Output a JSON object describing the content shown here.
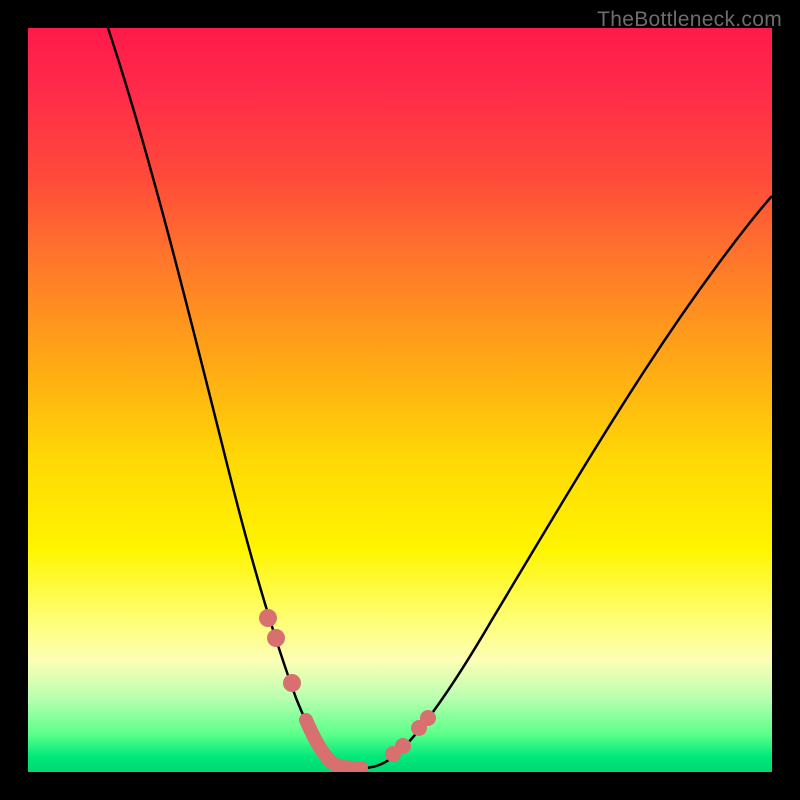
{
  "watermark": "TheBottleneck.com",
  "chart_data": {
    "type": "line",
    "title": "",
    "xlabel": "",
    "ylabel": "",
    "x_range": [
      0,
      100
    ],
    "y_range": [
      0,
      100
    ],
    "series": [
      {
        "name": "bottleneck-curve",
        "x": [
          10,
          13,
          16,
          19,
          22,
          25,
          28,
          30,
          32,
          34,
          36,
          38,
          40,
          44,
          48,
          52,
          56,
          60,
          65,
          70,
          75,
          80,
          85,
          90,
          95,
          100
        ],
        "y": [
          100,
          88,
          76,
          64,
          52,
          40,
          28,
          21,
          13,
          7,
          3,
          1,
          0,
          0,
          2,
          6,
          12,
          19,
          27,
          35,
          43,
          50,
          57,
          63,
          68,
          73
        ]
      }
    ],
    "markers": {
      "name": "highlight-points",
      "x": [
        31.5,
        33,
        37,
        38.5,
        40,
        42,
        44,
        46,
        48,
        50,
        52
      ],
      "y": [
        10,
        8,
        2,
        1,
        0.5,
        0.3,
        0.3,
        0.5,
        1.5,
        3,
        5.5
      ]
    },
    "gradient_stops": [
      {
        "pos": 0,
        "color": "#ff1a4a"
      },
      {
        "pos": 50,
        "color": "#ffd805"
      },
      {
        "pos": 85,
        "color": "#fcffb5"
      },
      {
        "pos": 100,
        "color": "#00d873"
      }
    ]
  }
}
